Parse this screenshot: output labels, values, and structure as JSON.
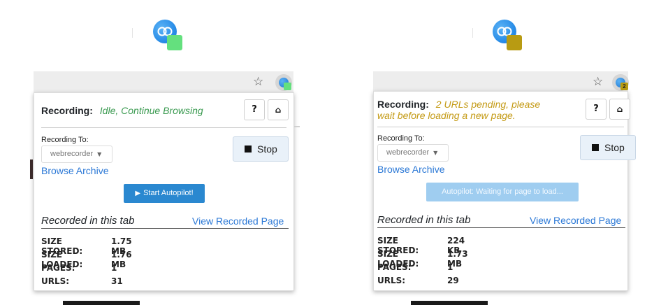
{
  "panels": [
    {
      "badge_color": "#64e07e",
      "status_label": "Recording:",
      "status_text": "Idle, Continue Browsing",
      "status_color": "#3a9a50",
      "help_label": "?",
      "home_icon": "home-icon",
      "recording_to_label": "Recording To:",
      "collection_value": "webrecorder",
      "browse_archive": "Browse Archive",
      "stop_label": "Stop",
      "autopilot_label": "Start Autopilot!",
      "autopilot_state": "ready",
      "recorded_title": "Recorded in this tab",
      "view_recorded": "View Recorded Page",
      "stats": [
        {
          "label": "SIZE STORED:",
          "value": "1.75 MB"
        },
        {
          "label": "SIZE LOADED:",
          "value": "1.76 MB"
        },
        {
          "label": "PAGES:",
          "value": "1"
        },
        {
          "label": "URLS:",
          "value": "31"
        }
      ]
    },
    {
      "badge_color": "#b89b12",
      "badge_count": "2",
      "status_label": "Recording:",
      "status_text_1": "2 URLs pending, please",
      "status_text_2": "wait before loading a new page.",
      "status_color": "#c49a14",
      "help_label": "?",
      "home_icon": "home-icon",
      "recording_to_label": "Recording To:",
      "collection_value": "webrecorder",
      "browse_archive": "Browse Archive",
      "stop_label": "Stop",
      "autopilot_label": "Autopilot: Waiting for page to load...",
      "autopilot_state": "waiting",
      "recorded_title": "Recorded in this tab",
      "view_recorded": "View Recorded Page",
      "stats": [
        {
          "label": "SIZE STORED:",
          "value": "224 KB"
        },
        {
          "label": "SIZE LOADED:",
          "value": "1.73 MB"
        },
        {
          "label": "PAGES:",
          "value": "1"
        },
        {
          "label": "URLS:",
          "value": "29"
        }
      ]
    }
  ],
  "icons": {
    "star": "☆",
    "home": "🏠",
    "play": "▶",
    "caret": "▼"
  }
}
